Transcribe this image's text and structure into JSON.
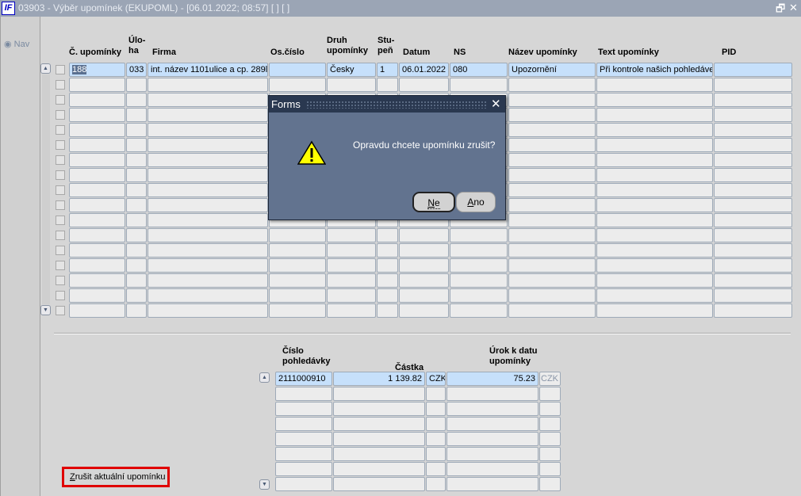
{
  "window": {
    "title": "03903 - Výběr upomínek (EKUPOML) - [06.01.2022; 08:57]  [ ]  [ ]",
    "icon": "IF",
    "restore": "🗗",
    "close": "✕"
  },
  "nav": {
    "label": "Nav"
  },
  "upper_table": {
    "headers": [
      [
        "Č. upomínky"
      ],
      [
        "Úlo-",
        "ha"
      ],
      [
        "Firma"
      ],
      [
        "Os.číslo"
      ],
      [
        "Druh",
        "upomínky"
      ],
      [
        "Stu-",
        "peň"
      ],
      [
        "Datum"
      ],
      [
        "NS"
      ],
      [
        "Název upomínky"
      ],
      [
        "Text upomínky"
      ],
      [
        "PID"
      ]
    ],
    "rows": [
      [
        "188",
        "033",
        "int. název 1101ulice a cp. 289l",
        "",
        "Česky",
        "1",
        "06.01.2022",
        "080",
        "Upozornění",
        "Při kontrole našich pohledáve",
        ""
      ]
    ],
    "row_count": 17
  },
  "lower_table": {
    "headers": [
      [
        "Číslo",
        "pohledávky"
      ],
      [
        "Částka"
      ],
      [
        ""
      ],
      [
        "Úrok k datu",
        "upomínky"
      ],
      [
        ""
      ]
    ],
    "rows": [
      [
        "2111000910",
        "1 139.82",
        "CZK",
        "75.23",
        "CZK"
      ]
    ],
    "row_count": 8
  },
  "cancel_button": "Zrušit aktuální upomínku",
  "dialog": {
    "title": "Forms",
    "message": "Opravdu chcete upomínku zrušit?",
    "no": "Ne",
    "yes": "Ano",
    "icon": "warning-icon"
  }
}
